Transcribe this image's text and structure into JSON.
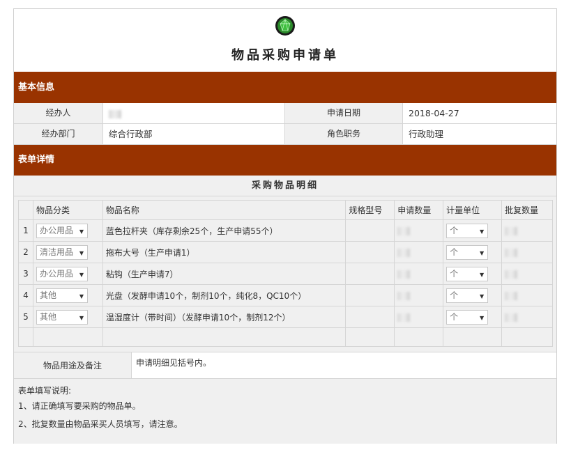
{
  "page": {
    "title": "物品采购申请单",
    "logo_icon": "green-gem-logo"
  },
  "colors": {
    "section_bar": "#993300",
    "label_bg": "#f0f0f0",
    "logo_green": "#2a8a2a"
  },
  "basic_info": {
    "section_label": "基本信息",
    "handler_label": "经办人",
    "handler_value": "",
    "date_label": "申请日期",
    "date_value": "2018-04-27",
    "dept_label": "经办部门",
    "dept_value": "综合行政部",
    "role_label": "角色职务",
    "role_value": "行政助理"
  },
  "detail": {
    "section_label": "表单详情",
    "table_title": "采购物品明细",
    "columns": [
      "物品分类",
      "物品名称",
      "规格型号",
      "申请数量",
      "计量单位",
      "批复数量"
    ],
    "rows": [
      {
        "idx": "1",
        "category": "办公用品",
        "name": "蓝色拉杆夹（库存剩余25个，生产申请55个）",
        "unit": "个"
      },
      {
        "idx": "2",
        "category": "清洁用品",
        "name": "拖布大号（生产申请1）",
        "unit": "个"
      },
      {
        "idx": "3",
        "category": "办公用品",
        "name": "粘钩（生产申请7）",
        "unit": "个"
      },
      {
        "idx": "4",
        "category": "其他",
        "name": "光盘（发酵申请10个，制剂10个，纯化8，QC10个）",
        "unit": "个"
      },
      {
        "idx": "5",
        "category": "其他",
        "name": "温湿度计（带时间）（发酵申请10个，制剂12个）",
        "unit": "个"
      }
    ]
  },
  "notes": {
    "label": "物品用途及备注",
    "value": "申请明细见括号内。"
  },
  "instructions": {
    "heading": "表单填写说明:",
    "items": [
      "1、请正确填写要采购的物品单。",
      "2、批复数量由物品采买人员填写，请注意。"
    ]
  }
}
